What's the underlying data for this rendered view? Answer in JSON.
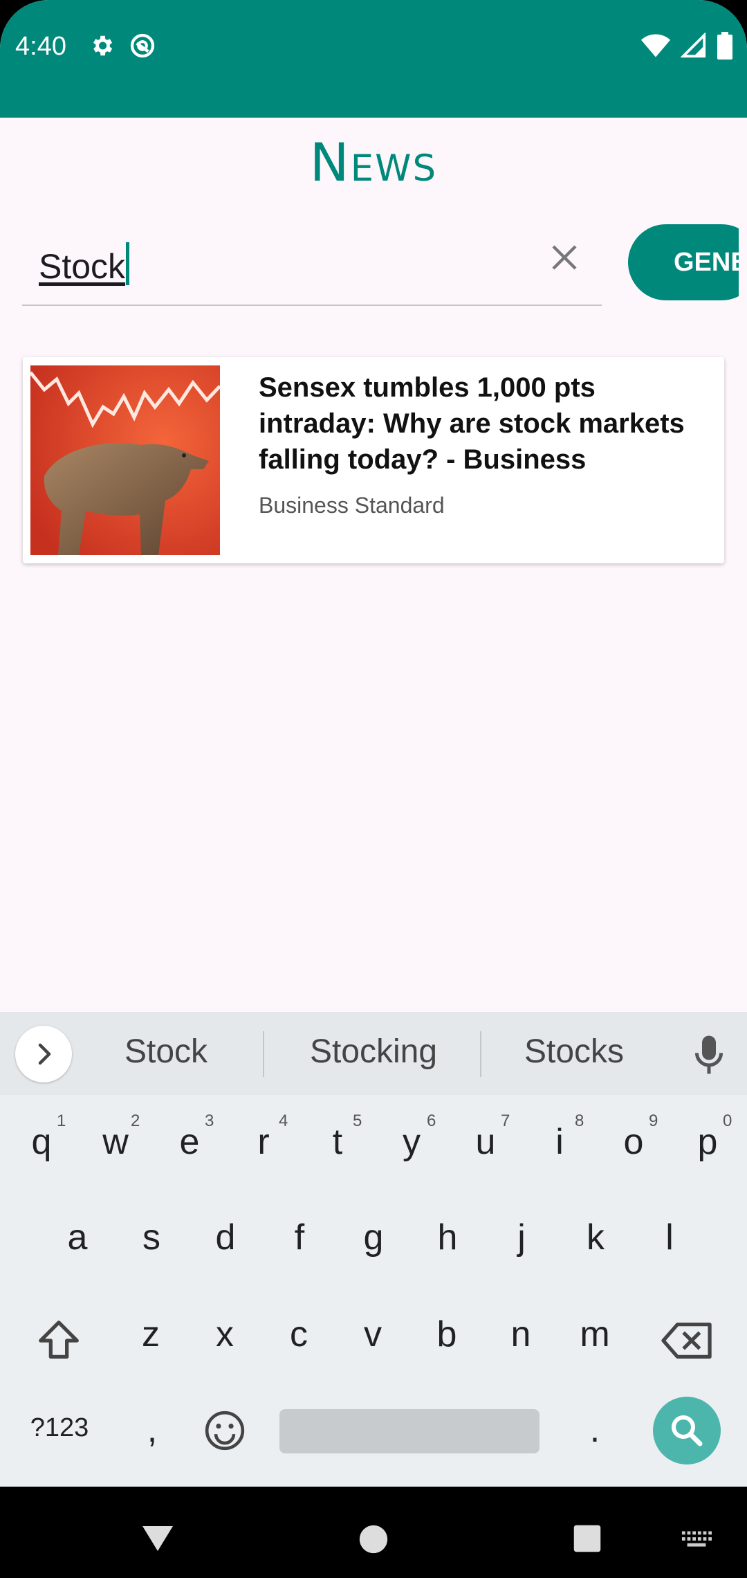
{
  "status_bar": {
    "time": "4:40"
  },
  "app": {
    "title": "News"
  },
  "search": {
    "value": "Stock",
    "category_button": "GENERAL"
  },
  "articles": [
    {
      "title": "Sensex tumbles 1,000 pts intraday: Why are stock markets falling today? - Business",
      "source": "Business Standard"
    }
  ],
  "keyboard": {
    "suggestions": [
      "Stock",
      "Stocking",
      "Stocks"
    ],
    "row1": [
      "q",
      "w",
      "e",
      "r",
      "t",
      "y",
      "u",
      "i",
      "o",
      "p"
    ],
    "row1_hints": [
      "1",
      "2",
      "3",
      "4",
      "5",
      "6",
      "7",
      "8",
      "9",
      "0"
    ],
    "row2": [
      "a",
      "s",
      "d",
      "f",
      "g",
      "h",
      "j",
      "k",
      "l"
    ],
    "row3": [
      "z",
      "x",
      "c",
      "v",
      "b",
      "n",
      "m"
    ],
    "symbols_key": "?123",
    "comma_key": ",",
    "period_key": "."
  },
  "colors": {
    "primary": "#00897b",
    "accent_key": "#4db6ac",
    "background": "#fdf7fc"
  },
  "icons": [
    "settings-icon",
    "do-not-disturb-icon",
    "wifi-icon",
    "signal-icon",
    "battery-icon",
    "close-icon",
    "chevron-right-icon",
    "mic-icon",
    "shift-icon",
    "backspace-icon",
    "emoji-icon",
    "search-icon",
    "back-icon",
    "home-icon",
    "recents-icon",
    "keyboard-icon"
  ]
}
